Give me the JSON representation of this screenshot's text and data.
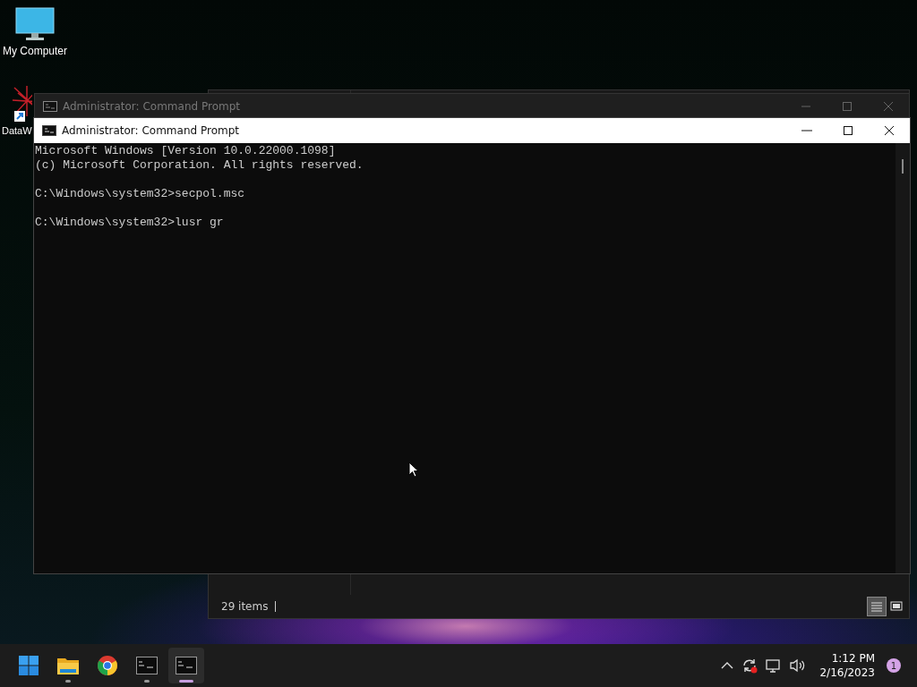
{
  "desktop_icons": [
    {
      "kind": "computer",
      "label": "My Computer"
    },
    {
      "kind": "shortcut",
      "label": "DataW"
    }
  ],
  "explorer_window": {
    "status_text": "29 items",
    "views": [
      {
        "kind": "details",
        "selected": true
      },
      {
        "kind": "tiles",
        "selected": false
      }
    ]
  },
  "back_window": {
    "title": "Administrator:  Command Prompt"
  },
  "front_window": {
    "title": "Administrator:  Command Prompt",
    "console_blocks": [
      [
        "Microsoft Windows [Version 10.0.22000.1098]",
        "(c) Microsoft Corporation. All rights reserved."
      ],
      [
        "C:\\Windows\\system32>secpol.msc"
      ],
      [
        "C:\\Windows\\system32>lusr gr"
      ]
    ]
  },
  "taskbar": {
    "apps": [
      {
        "kind": "start",
        "running": false,
        "selected": false
      },
      {
        "kind": "folder",
        "running": true,
        "selected": false
      },
      {
        "kind": "chrome",
        "running": false,
        "selected": false
      },
      {
        "kind": "terminal",
        "running": true,
        "selected": false
      },
      {
        "kind": "terminal",
        "running": true,
        "selected": true
      }
    ],
    "time": "1:12 PM",
    "date": "2/16/2023",
    "notification_count": "1"
  }
}
